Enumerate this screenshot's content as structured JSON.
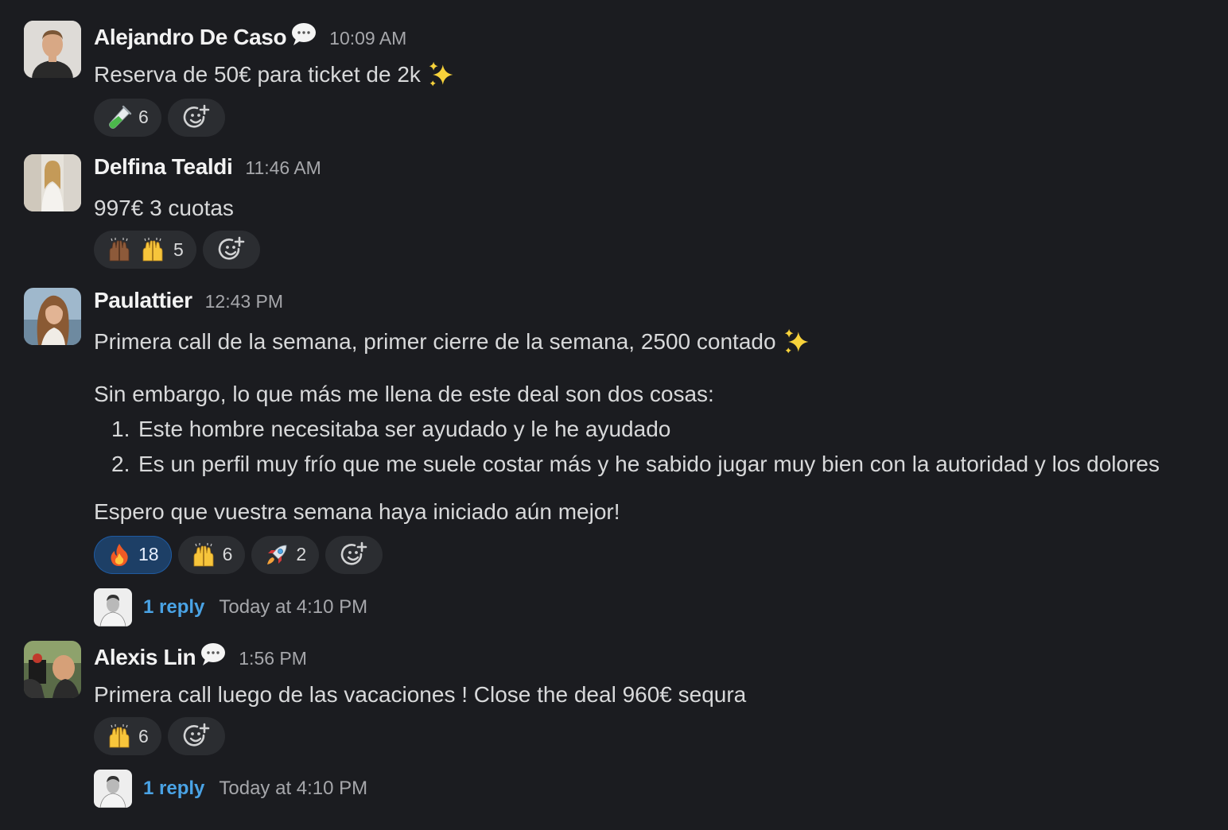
{
  "messages": [
    {
      "author": "Alejandro De Caso",
      "time": "10:09 AM",
      "text": "Reserva de 50€ para ticket de 2k",
      "reactions": [
        {
          "emoji": "test-tube",
          "count": "6"
        }
      ]
    },
    {
      "author": "Delfina Tealdi",
      "time": "11:46 AM",
      "text": "997€ 3 cuotas",
      "reactions": [
        {
          "emoji": "raised-hands-x2",
          "count": "5"
        }
      ]
    },
    {
      "author": "Paulattier",
      "time": "12:43 PM",
      "text": "Primera call de la semana, primer cierre de la semana, 2500 contado",
      "text2": "Sin embargo, lo que más me llena de este deal son dos cosas:",
      "list": [
        {
          "num": "1.",
          "text": "Este hombre necesitaba ser ayudado y le he ayudado"
        },
        {
          "num": "2.",
          "text": "Es un perfil muy frío que me suele costar más y he sabido jugar muy bien con la autoridad y los dolores"
        }
      ],
      "text3": "Espero que vuestra semana haya iniciado aún mejor!",
      "reactions": [
        {
          "emoji": "fire",
          "count": "18"
        },
        {
          "emoji": "raised-hands",
          "count": "6"
        },
        {
          "emoji": "rocket",
          "count": "2"
        }
      ],
      "thread": {
        "replies": "1 reply",
        "time": "Today at 4:10 PM"
      }
    },
    {
      "author": "Alexis Lin",
      "time": "1:56 PM",
      "text": "Primera call luego de las vacaciones ! Close the deal 960€ sequra",
      "reactions": [
        {
          "emoji": "raised-hands",
          "count": "6"
        }
      ],
      "thread": {
        "replies": "1 reply",
        "time": "Today at 4:10 PM"
      }
    }
  ],
  "colors": {
    "background": "#1b1c20",
    "pill": "#2b2d31",
    "pill_active": "#1d3f66",
    "link": "#4aa3e5"
  },
  "icons": [
    "speech-bubble-icon",
    "sparkles-icon",
    "add-reaction-icon"
  ]
}
